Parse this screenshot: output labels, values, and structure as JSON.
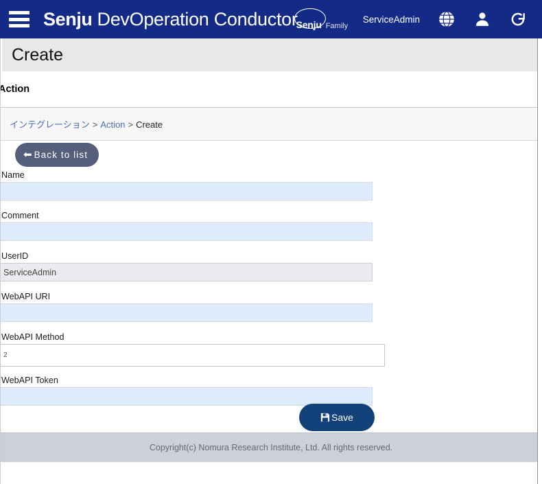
{
  "header": {
    "menu_icon": "hamburger-icon",
    "brand_bold": "Senju",
    "brand_light": "DevOperation Conductor",
    "family_mark": "Senju",
    "family_word": "Family",
    "user_name": "ServiceAdmin",
    "icons": [
      "globe-icon",
      "user-icon",
      "refresh-icon"
    ],
    "background_color": "#132b86"
  },
  "title_bar": {
    "title": "Create",
    "background_color": "#e8e8e8"
  },
  "section": {
    "title": "Action"
  },
  "breadcrumb": {
    "items": [
      {
        "label": "インテグレーション",
        "is_link": true
      },
      {
        "label": "Action",
        "is_link": true
      },
      {
        "label": "Create",
        "is_link": false
      }
    ],
    "separator": ">",
    "link_color": "#4a6fb5"
  },
  "toolbar": {
    "back_label": "Back to list",
    "back_icon": "arrow-left-icon",
    "back_color": "#555f7b"
  },
  "form": {
    "fields": [
      {
        "label": "Name",
        "value": "",
        "placeholder": "",
        "type": "text",
        "style": "highlight",
        "readonly": false
      },
      {
        "label": "Comment",
        "value": "",
        "placeholder": "",
        "type": "text",
        "style": "highlight",
        "readonly": false
      },
      {
        "label": "UserID",
        "value": "ServiceAdmin",
        "placeholder": "",
        "type": "text",
        "style": "readonly",
        "readonly": true
      },
      {
        "label": "WebAPI URI",
        "value": "",
        "placeholder": "",
        "type": "text",
        "style": "highlight",
        "readonly": false
      },
      {
        "label": "WebAPI Method",
        "value": "2",
        "placeholder": "",
        "type": "text",
        "style": "plain",
        "readonly": false
      },
      {
        "label": "WebAPI Token",
        "value": "",
        "placeholder": "",
        "type": "text",
        "style": "highlight",
        "readonly": false
      }
    ]
  },
  "actions": {
    "save_label": "Save",
    "save_icon": "floppy-save-icon",
    "save_color": "#124078"
  },
  "footer": {
    "copyright": "Copyright(c) Nomura Research Institute, Ltd. All rights reserved.",
    "background_color": "#ccd0db"
  }
}
